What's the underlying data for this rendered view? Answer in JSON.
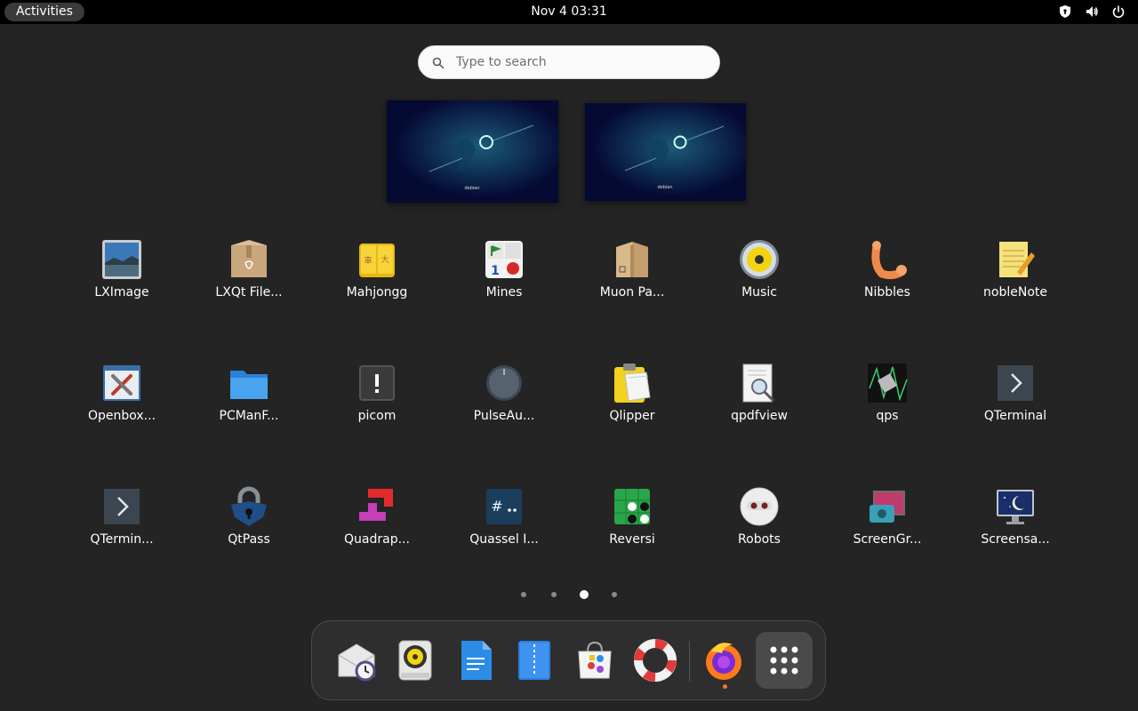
{
  "topbar": {
    "activities_label": "Activities",
    "clock": "Nov 4  03:31",
    "tray_icons": [
      "shield-icon",
      "volume-icon",
      "power-icon"
    ]
  },
  "search": {
    "placeholder": "Type to search",
    "value": ""
  },
  "workspaces": [
    {
      "name": "workspace-1",
      "label": "debian"
    },
    {
      "name": "workspace-2",
      "label": "debian"
    }
  ],
  "apps": [
    {
      "label": "LXImage",
      "icon": "lximage-icon"
    },
    {
      "label": "LXQt File...",
      "icon": "lxqt-file-archiver-icon"
    },
    {
      "label": "Mahjongg",
      "icon": "mahjongg-icon"
    },
    {
      "label": "Mines",
      "icon": "mines-icon"
    },
    {
      "label": "Muon Pa...",
      "icon": "muon-package-manager-icon"
    },
    {
      "label": "Music",
      "icon": "music-icon"
    },
    {
      "label": "Nibbles",
      "icon": "nibbles-icon"
    },
    {
      "label": "nobleNote",
      "icon": "noblenote-icon"
    },
    {
      "label": "Openbox...",
      "icon": "openbox-config-icon"
    },
    {
      "label": "PCManF...",
      "icon": "pcmanfm-folder-icon"
    },
    {
      "label": "picom",
      "icon": "picom-icon"
    },
    {
      "label": "PulseAu...",
      "icon": "pulseaudio-knob-icon"
    },
    {
      "label": "Qlipper",
      "icon": "qlipper-clipboard-icon"
    },
    {
      "label": "qpdfview",
      "icon": "qpdfview-icon"
    },
    {
      "label": "qps",
      "icon": "qps-chip-icon"
    },
    {
      "label": "QTerminal",
      "icon": "qterminal-icon"
    },
    {
      "label": "QTermin...",
      "icon": "qterminal-drop-icon"
    },
    {
      "label": "QtPass",
      "icon": "qtpass-lock-icon"
    },
    {
      "label": "Quadrap...",
      "icon": "quadrapassel-icon"
    },
    {
      "label": "Quassel I...",
      "icon": "quassel-irc-icon"
    },
    {
      "label": "Reversi",
      "icon": "reversi-icon"
    },
    {
      "label": "Robots",
      "icon": "robots-icon"
    },
    {
      "label": "ScreenGr...",
      "icon": "screengrab-icon"
    },
    {
      "label": "Screensa...",
      "icon": "screensaver-icon"
    }
  ],
  "pagination": {
    "pages": 4,
    "current_page": 3
  },
  "dock": {
    "items": [
      {
        "name": "evolution-mail-icon"
      },
      {
        "name": "rhythmbox-icon"
      },
      {
        "name": "text-document-icon"
      },
      {
        "name": "file-archive-icon"
      },
      {
        "name": "software-store-icon"
      },
      {
        "name": "help-lifebuoy-icon"
      },
      {
        "name": "firefox-icon",
        "running": true
      }
    ],
    "show_apps": "show-apps-grid-icon"
  }
}
